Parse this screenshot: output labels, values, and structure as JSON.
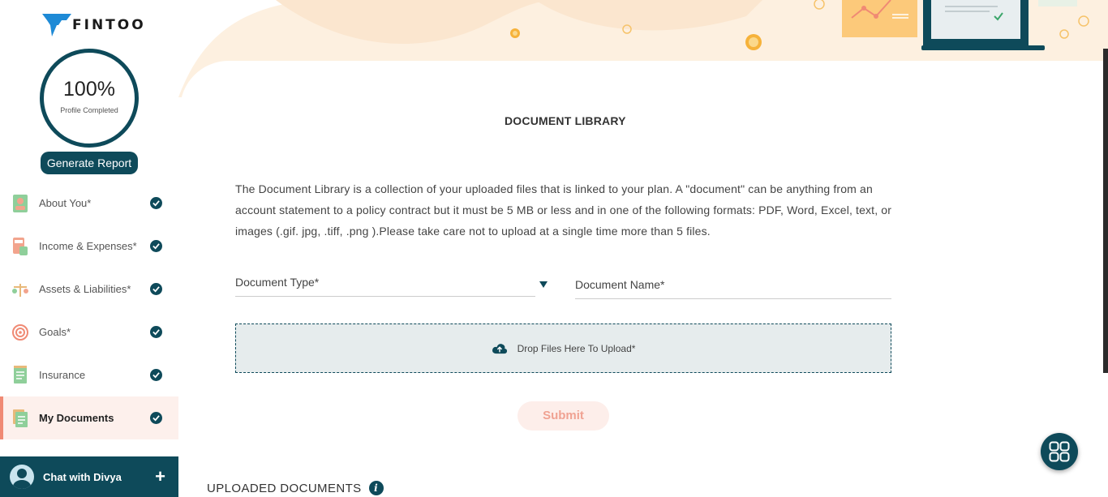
{
  "brand": {
    "name": "FINTOO"
  },
  "profile": {
    "percent": "100%",
    "caption": "Profile Completed"
  },
  "sidebar": {
    "generate_report": "Generate Report",
    "items": [
      {
        "label": "About You*",
        "icon": "person-card-icon",
        "completed": true,
        "active": false
      },
      {
        "label": "Income & Expenses*",
        "icon": "calculator-icon",
        "completed": true,
        "active": false
      },
      {
        "label": "Assets & Liabilities*",
        "icon": "scale-icon",
        "completed": true,
        "active": false
      },
      {
        "label": "Goals*",
        "icon": "target-icon",
        "completed": true,
        "active": false
      },
      {
        "label": "Insurance",
        "icon": "insurance-doc-icon",
        "completed": true,
        "active": false
      },
      {
        "label": "My Documents",
        "icon": "documents-icon",
        "completed": true,
        "active": true
      }
    ],
    "chat": {
      "label": "Chat with Divya",
      "plus": "+"
    }
  },
  "main": {
    "title": "DOCUMENT LIBRARY",
    "intro": "The Document Library is a collection of your uploaded files that is linked to your plan. A \"document\" can be anything from an account statement to a policy contract but it must be 5 MB or less and in one of the following formats: PDF, Word, Excel, text, or images (.gif. jpg, .tiff, .png ).Please take care not to upload at a single time more than 5 files.",
    "document_type_label": "Document Type*",
    "document_name_label": "Document Name*",
    "drop_label": "Drop Files Here To Upload*",
    "submit_label": "Submit",
    "uploaded_title": "UPLOADED DOCUMENTS",
    "info_glyph": "i"
  },
  "colors": {
    "primary": "#0e4a5a",
    "accent": "#f08a74",
    "banner": "#fdf0e0"
  }
}
